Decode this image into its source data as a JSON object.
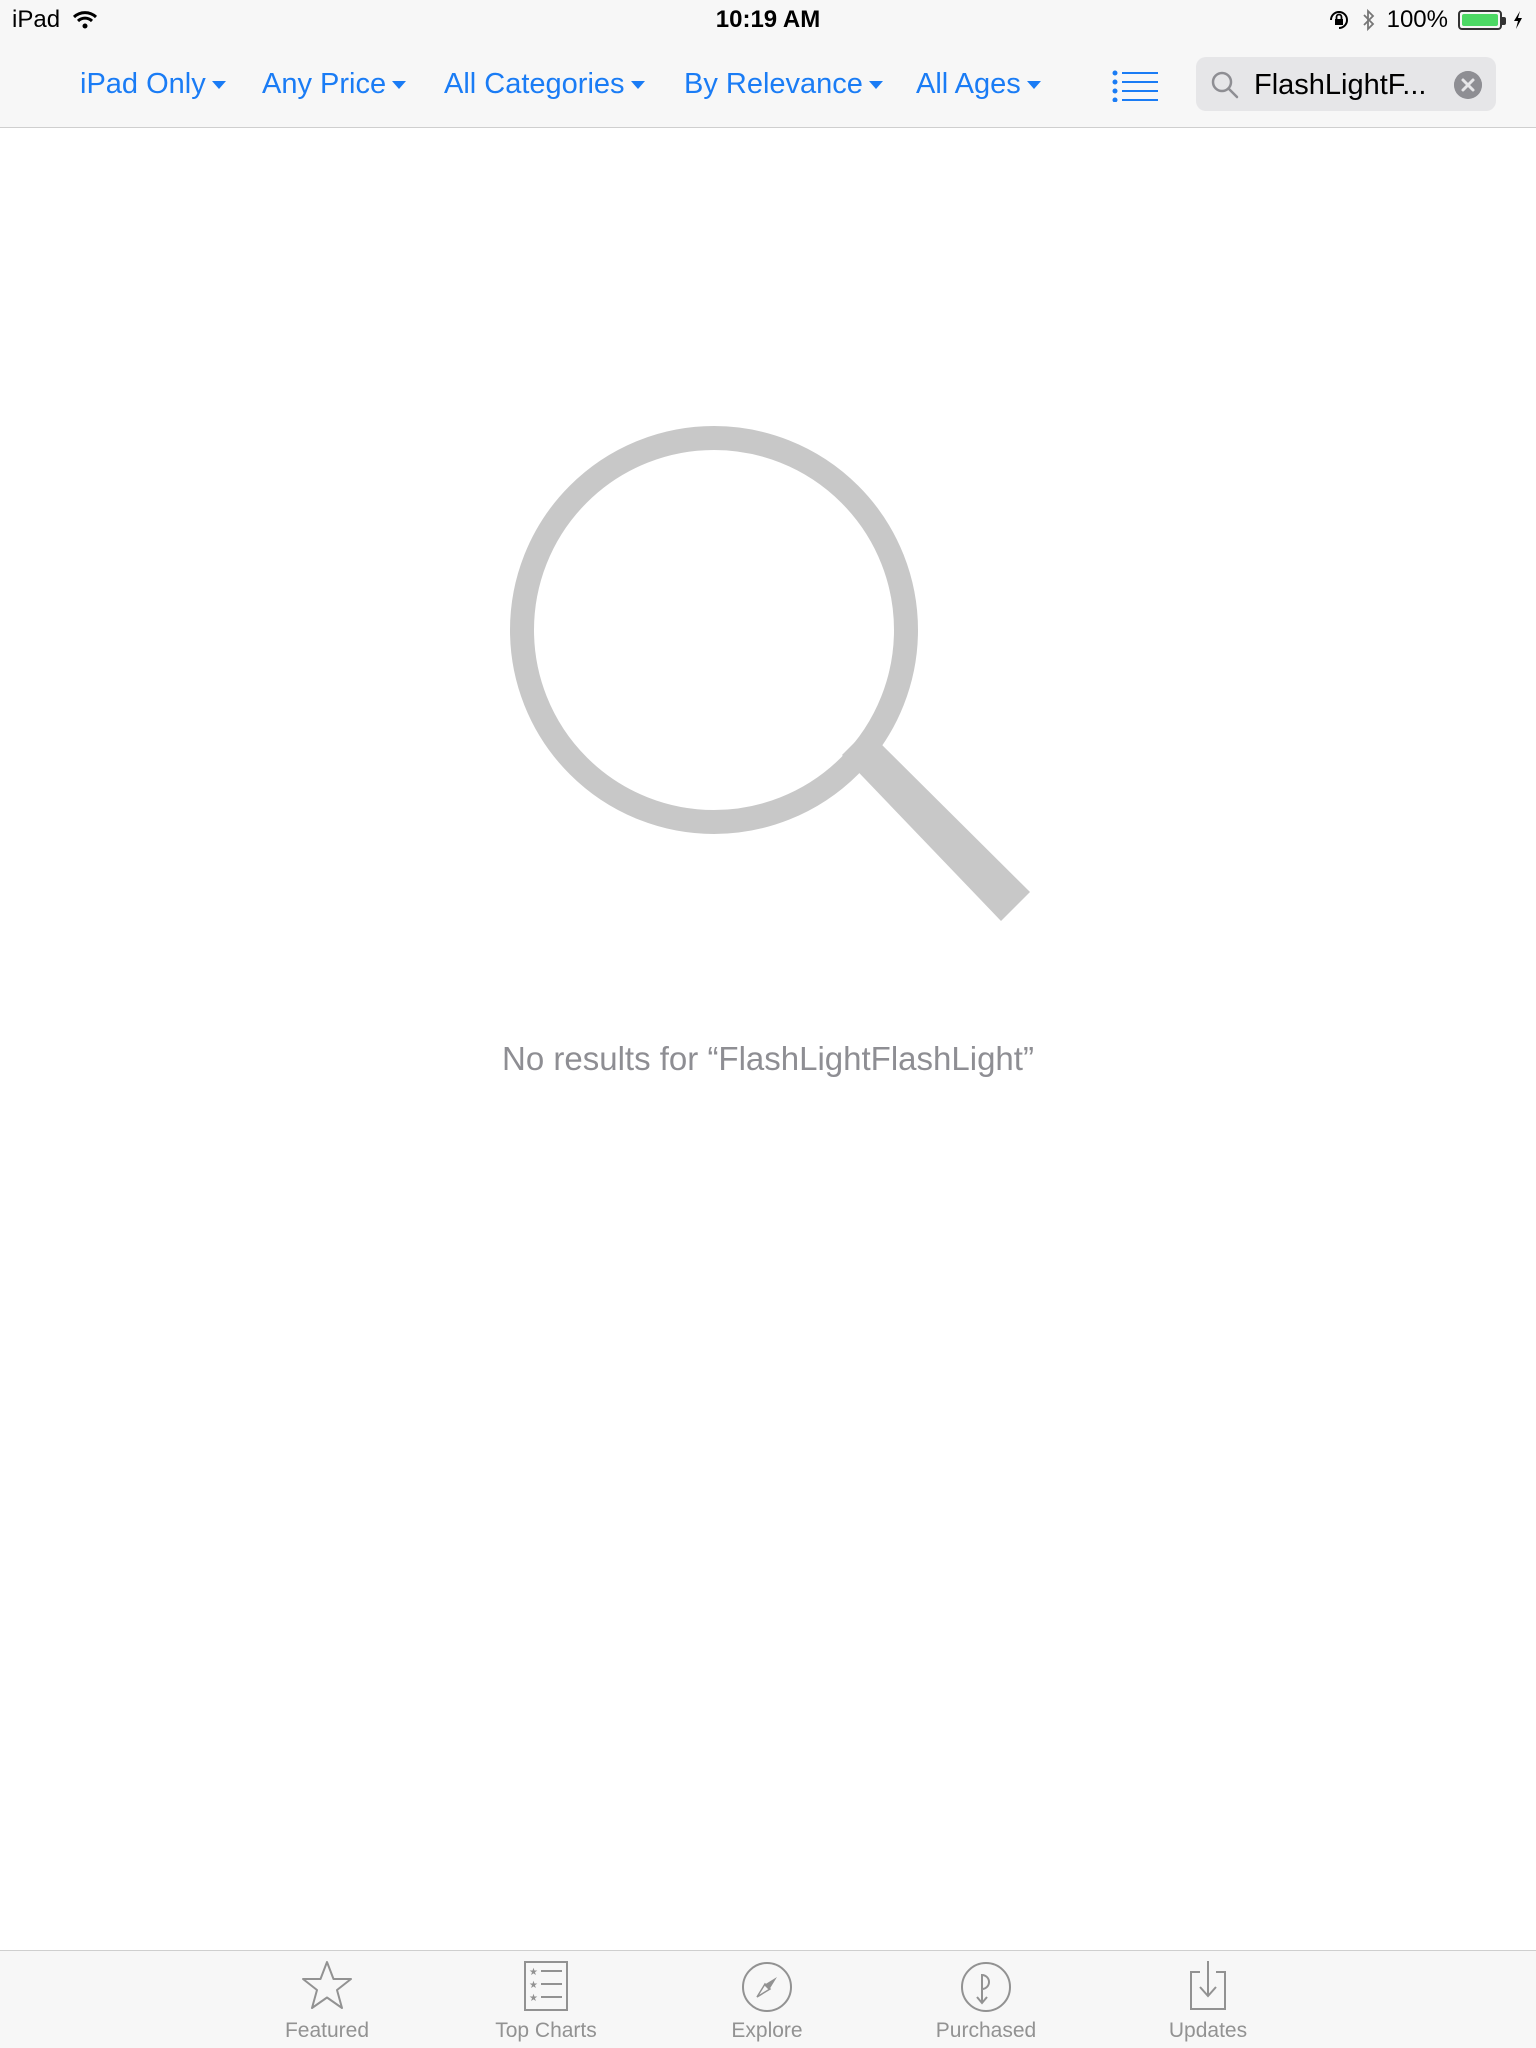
{
  "status_bar": {
    "device": "iPad",
    "time": "10:19 AM",
    "battery": "100%"
  },
  "filters": [
    {
      "label": "iPad Only"
    },
    {
      "label": "Any Price"
    },
    {
      "label": "All Categories"
    },
    {
      "label": "By Relevance"
    },
    {
      "label": "All Ages"
    }
  ],
  "search": {
    "value": "FlashLightF..."
  },
  "empty_state": {
    "message": "No results for “FlashLightFlashLight”"
  },
  "tabs": [
    {
      "label": "Featured",
      "icon": "star-icon"
    },
    {
      "label": "Top Charts",
      "icon": "top-charts-icon"
    },
    {
      "label": "Explore",
      "icon": "compass-icon"
    },
    {
      "label": "Purchased",
      "icon": "purchased-icon"
    },
    {
      "label": "Updates",
      "icon": "updates-icon"
    }
  ],
  "colors": {
    "accent": "#1a7cf5",
    "muted": "#8e8e93",
    "bar_background": "#f7f7f7",
    "battery": "#4cd964"
  }
}
